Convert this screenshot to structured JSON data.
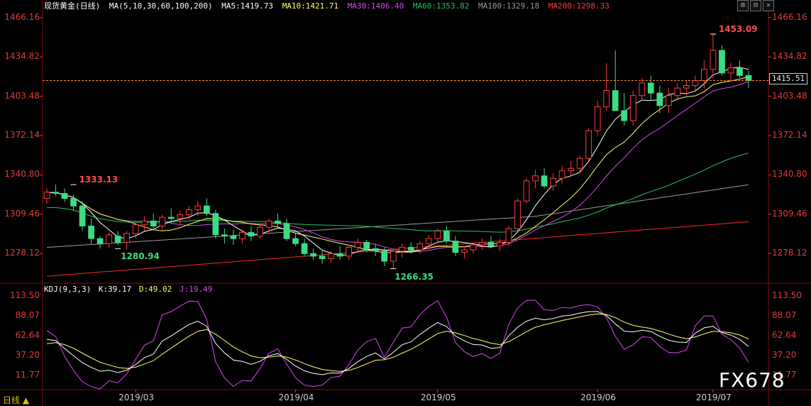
{
  "header": {
    "title": "现货黄金(日线)",
    "ma_spec": "MA(5,10,30,60,100,200)",
    "ma5": "MA5:1419.73",
    "ma10": "MA10:1421.71",
    "ma30": "MA30:1406.40",
    "ma60": "MA60:1353.82",
    "ma100": "MA100:1329.18",
    "ma200": "MA200:1298.33"
  },
  "kdj_header": {
    "spec": "KDJ(9,3,3)",
    "k": "K:39.17",
    "d": "D:49.02",
    "j": "J:19.49"
  },
  "current_price_label": "1415.51",
  "period_tab": "日线 ▲",
  "watermark": "FX678",
  "colors": {
    "up": "#ff3b3b",
    "down": "#3ddc84",
    "ma5": "#ffffff",
    "ma10": "#ffff66",
    "ma30": "#d946ef",
    "ma60": "#22c55e",
    "ma100": "#9a9a9a",
    "ma200": "#ff2a2a",
    "k": "#ffffff",
    "d": "#ffff66",
    "j": "#d946ef",
    "axis": "#e23b3b",
    "grid": "#7a1010"
  },
  "chart_data": [
    {
      "type": "candlestick",
      "y_ticks": [
        "1466.16",
        "1434.82",
        "1403.48",
        "1372.14",
        "1340.80",
        "1309.46",
        "1278.12"
      ],
      "ylim": [
        1255,
        1470
      ],
      "annotations": [
        {
          "text": "1333.13",
          "kind": "high"
        },
        {
          "text": "1280.94",
          "kind": "low"
        },
        {
          "text": "1266.35",
          "kind": "low"
        },
        {
          "text": "1453.09",
          "kind": "high"
        }
      ],
      "x_labels": [
        "2019/03",
        "2019/04",
        "2019/05",
        "2019/06",
        "2019/07"
      ],
      "ohlc": [
        [
          1322,
          1330,
          1318,
          1327
        ],
        [
          1327,
          1333,
          1324,
          1326
        ],
        [
          1326,
          1330,
          1319,
          1322
        ],
        [
          1322,
          1325,
          1312,
          1316
        ],
        [
          1316,
          1320,
          1296,
          1300
        ],
        [
          1300,
          1306,
          1285,
          1290
        ],
        [
          1290,
          1292,
          1282,
          1286
        ],
        [
          1286,
          1295,
          1283,
          1293
        ],
        [
          1292,
          1296,
          1285,
          1287
        ],
        [
          1287,
          1296,
          1281,
          1294
        ],
        [
          1294,
          1303,
          1290,
          1301
        ],
        [
          1301,
          1308,
          1296,
          1304
        ],
        [
          1304,
          1310,
          1298,
          1300
        ],
        [
          1300,
          1309,
          1297,
          1307
        ],
        [
          1307,
          1314,
          1302,
          1306
        ],
        [
          1306,
          1312,
          1301,
          1309
        ],
        [
          1309,
          1316,
          1305,
          1313
        ],
        [
          1313,
          1320,
          1308,
          1316
        ],
        [
          1316,
          1322,
          1308,
          1310
        ],
        [
          1310,
          1313,
          1290,
          1293
        ],
        [
          1293,
          1298,
          1286,
          1292
        ],
        [
          1292,
          1297,
          1285,
          1290
        ],
        [
          1290,
          1297,
          1286,
          1295
        ],
        [
          1295,
          1300,
          1288,
          1292
        ],
        [
          1292,
          1302,
          1290,
          1299
        ],
        [
          1299,
          1306,
          1295,
          1304
        ],
        [
          1304,
          1310,
          1298,
          1302
        ],
        [
          1302,
          1306,
          1288,
          1290
        ],
        [
          1290,
          1294,
          1284,
          1286
        ],
        [
          1286,
          1290,
          1276,
          1278
        ],
        [
          1278,
          1282,
          1273,
          1276
        ],
        [
          1276,
          1281,
          1270,
          1274
        ],
        [
          1274,
          1280,
          1271,
          1278
        ],
        [
          1278,
          1284,
          1273,
          1276
        ],
        [
          1276,
          1285,
          1273,
          1283
        ],
        [
          1283,
          1290,
          1279,
          1287
        ],
        [
          1287,
          1289,
          1279,
          1282
        ],
        [
          1282,
          1286,
          1276,
          1280
        ],
        [
          1280,
          1283,
          1268,
          1272
        ],
        [
          1272,
          1282,
          1266,
          1280
        ],
        [
          1280,
          1286,
          1275,
          1283
        ],
        [
          1283,
          1287,
          1278,
          1281
        ],
        [
          1281,
          1288,
          1278,
          1286
        ],
        [
          1286,
          1293,
          1282,
          1290
        ],
        [
          1290,
          1298,
          1286,
          1296
        ],
        [
          1296,
          1300,
          1286,
          1288
        ],
        [
          1288,
          1292,
          1276,
          1279
        ],
        [
          1279,
          1284,
          1274,
          1281
        ],
        [
          1281,
          1287,
          1278,
          1285
        ],
        [
          1285,
          1290,
          1281,
          1287
        ],
        [
          1287,
          1292,
          1283,
          1284
        ],
        [
          1284,
          1290,
          1280,
          1287
        ],
        [
          1287,
          1300,
          1284,
          1298
        ],
        [
          1298,
          1322,
          1296,
          1320
        ],
        [
          1320,
          1338,
          1318,
          1336
        ],
        [
          1336,
          1345,
          1330,
          1340
        ],
        [
          1340,
          1346,
          1330,
          1332
        ],
        [
          1332,
          1342,
          1328,
          1338
        ],
        [
          1338,
          1348,
          1334,
          1344
        ],
        [
          1344,
          1352,
          1340,
          1346
        ],
        [
          1346,
          1356,
          1342,
          1354
        ],
        [
          1354,
          1378,
          1352,
          1376
        ],
        [
          1376,
          1400,
          1372,
          1395
        ],
        [
          1395,
          1430,
          1392,
          1408
        ],
        [
          1408,
          1440,
          1400,
          1392
        ],
        [
          1392,
          1406,
          1380,
          1384
        ],
        [
          1384,
          1408,
          1380,
          1404
        ],
        [
          1404,
          1418,
          1400,
          1414
        ],
        [
          1414,
          1420,
          1400,
          1406
        ],
        [
          1406,
          1412,
          1390,
          1396
        ],
        [
          1396,
          1410,
          1390,
          1404
        ],
        [
          1404,
          1414,
          1400,
          1410
        ],
        [
          1410,
          1416,
          1404,
          1412
        ],
        [
          1412,
          1420,
          1408,
          1416
        ],
        [
          1416,
          1432,
          1410,
          1425
        ],
        [
          1425,
          1453,
          1418,
          1440
        ],
        [
          1440,
          1444,
          1420,
          1422
        ],
        [
          1422,
          1430,
          1415,
          1426
        ],
        [
          1426,
          1432,
          1418,
          1420
        ],
        [
          1420,
          1424,
          1410,
          1416
        ]
      ]
    },
    {
      "type": "line",
      "name": "KDJ",
      "y_ticks": [
        "113.50",
        "88.07",
        "62.64",
        "37.20",
        "11.77"
      ],
      "ylim": [
        -5,
        120
      ]
    }
  ]
}
